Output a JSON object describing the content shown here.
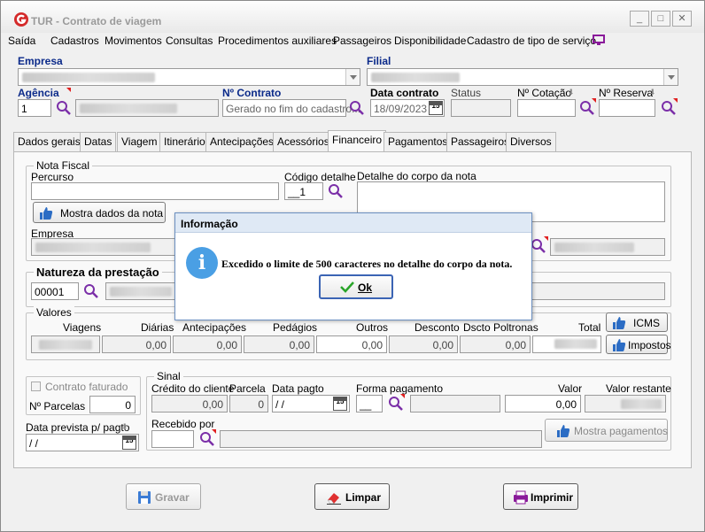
{
  "window": {
    "title": "TUR - Contrato de viagem"
  },
  "menu": [
    "Saída",
    "Cadastros",
    "Movimentos",
    "Consultas",
    "Procedimentos auxiliares",
    "Passageiros",
    "Disponibilidade",
    "Cadastro de tipo de serviço"
  ],
  "header": {
    "empresa_label": "Empresa",
    "filial_label": "Filial",
    "agencia_label": "Agência",
    "agencia_value": "1",
    "contrato_label": "Nº Contrato",
    "contrato_value": "Gerado no fim do cadastro...",
    "data_contrato_label": "Data contrato",
    "data_contrato_value": "18/09/2023",
    "status_label": "Status",
    "cotacao_label": "Nº Cotação",
    "reserva_label": "Nº Reserva"
  },
  "tabs": [
    "Dados gerais",
    "Datas",
    "Viagem",
    "Itinerário",
    "Antecipações",
    "Acessórios",
    "Financeiro",
    "Pagamentos",
    "Passageiros",
    "Diversos"
  ],
  "active_tab": "Financeiro",
  "nota_fiscal": {
    "title": "Nota Fiscal",
    "percurso_label": "Percurso",
    "codigo_label": "Código detalhe",
    "codigo_value": "__1",
    "detalhe_label": "Detalhe do corpo da nota",
    "mostra_button": "Mostra dados da nota",
    "empresa_label": "Empresa"
  },
  "natureza": {
    "title": "Natureza da prestação",
    "code": "00001"
  },
  "valores": {
    "title": "Valores",
    "columns": [
      "Viagens",
      "Diárias",
      "Antecipações",
      "Pedágios",
      "Outros",
      "Desconto",
      "Dscto Poltronas",
      "Total"
    ],
    "values": [
      "0,00",
      "0,00",
      "0,00",
      "0,00",
      "0,00",
      "0,00"
    ],
    "icms_button": "ICMS",
    "impostos_button": "Impostos"
  },
  "left_box": {
    "faturado_label": "Contrato faturado",
    "parcelas_label": "Nº Parcelas",
    "parcelas_value": "0",
    "data_prevista_label": "Data prevista p/ pagto",
    "data_prevista_value": " /  /"
  },
  "sinal": {
    "title": "Sinal",
    "credito_label": "Crédito do cliente",
    "credito_value": "0,00",
    "parcela_label": "Parcela",
    "parcela_value": "0",
    "data_pagto_label": "Data pagto",
    "data_pagto_value": " /  /",
    "forma_label": "Forma pagamento",
    "forma_value": "__",
    "valor_label": "Valor",
    "valor_value": "0,00",
    "restante_label": "Valor restante",
    "recebido_label": "Recebido por",
    "mostra_pag_button": "Mostra pagamentos"
  },
  "footer": {
    "gravar": "Gravar",
    "limpar": "Limpar",
    "imprimir": "Imprimir"
  },
  "dialog": {
    "title": "Informação",
    "message": "Excedido o limite de 500 caracteres no detalhe do corpo da nota.",
    "ok": "Ok"
  },
  "colors": {
    "accent_blue": "#0b2a8a",
    "info_blue": "#4a9fe4",
    "logo_red": "#d42a2a"
  }
}
